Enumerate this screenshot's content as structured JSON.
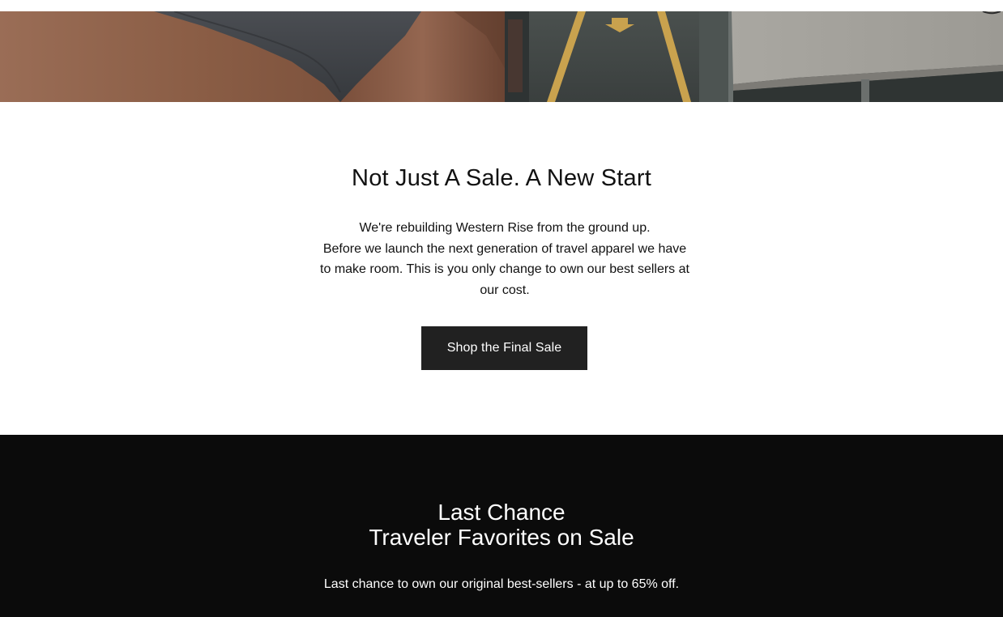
{
  "intro": {
    "title": "Not Just A Sale. A New Start",
    "body_lines": [
      "We're rebuilding Western Rise from the ground up.",
      "Before we launch the next generation of travel apparel we have",
      "to make room. This is you only change to own our best sellers at",
      "our cost."
    ],
    "cta_label": "Shop the Final Sale"
  },
  "last_chance": {
    "title_lines": [
      "Last Chance",
      "Traveler Favorites on Sale"
    ],
    "subtitle": "Last chance to own our original best-sellers - at up to 65% off."
  },
  "colors": {
    "cta_background": "#212121",
    "dark_section_background": "#0b0b0b"
  }
}
